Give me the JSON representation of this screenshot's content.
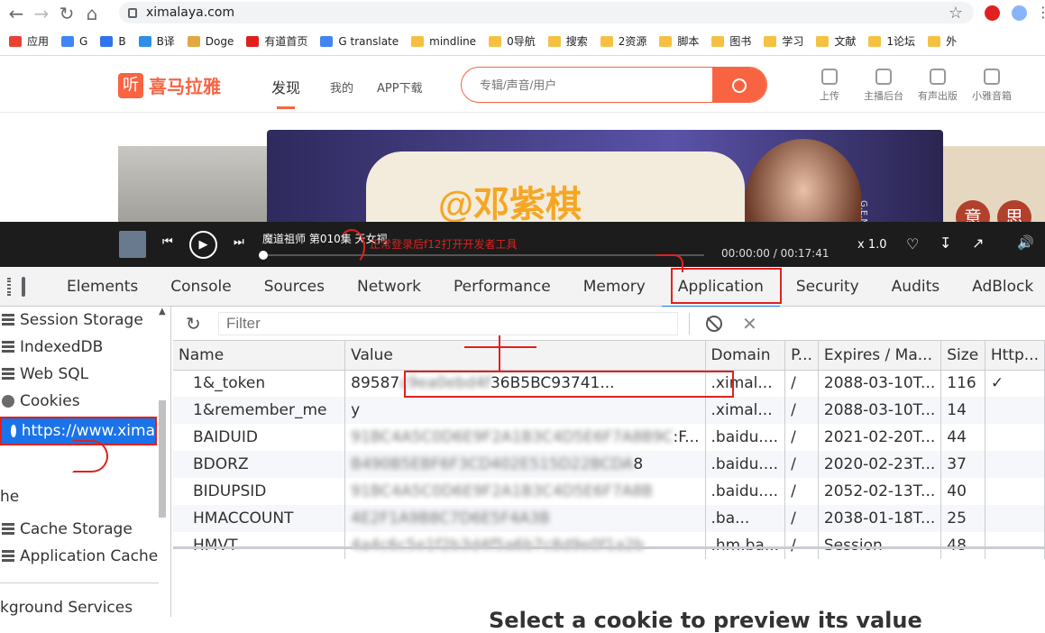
{
  "browser": {
    "url": "ximalaya.com",
    "bookmarks": [
      {
        "label": "应用",
        "color": "#e94235"
      },
      {
        "label": "G",
        "color": "#4285f4"
      },
      {
        "label": "B",
        "color": "#2f73ee"
      },
      {
        "label": "B译",
        "color": "#2e8fe8"
      },
      {
        "label": "Doge",
        "color": "#e3a742"
      },
      {
        "label": "有道首页",
        "color": "#e02020"
      },
      {
        "label": "G translate",
        "color": "#4285f4"
      },
      {
        "label": "mindline",
        "color": "#f6c142"
      },
      {
        "label": "0导航",
        "color": "#f6c142"
      },
      {
        "label": "搜索",
        "color": "#f6c142"
      },
      {
        "label": "2资源",
        "color": "#f6c142"
      },
      {
        "label": "脚本",
        "color": "#f6c142"
      },
      {
        "label": "图书",
        "color": "#f6c142"
      },
      {
        "label": "学习",
        "color": "#f6c142"
      },
      {
        "label": "文献",
        "color": "#f6c142"
      },
      {
        "label": "1论坛",
        "color": "#f6c142"
      },
      {
        "label": "外",
        "color": "#f6c142"
      }
    ]
  },
  "site": {
    "logo": "喜马拉雅",
    "nav": [
      "发现",
      "我的",
      "APP下载"
    ],
    "search_placeholder": "专辑/声音/用户",
    "right_icons": [
      "上传",
      "主播后台",
      "有声出版",
      "小雅音箱"
    ],
    "banner_text": "@邓紫棋",
    "banner_tag": "G.E.M.",
    "banner_right_chars": [
      "意",
      "思"
    ]
  },
  "player": {
    "track": "魔道祖师 第010集 天女祠",
    "time": "00:00:00 / 00:17:41",
    "speed": "x 1.0"
  },
  "annotations": {
    "step1": "正常登录后f12打开开发者工具"
  },
  "devtools": {
    "tabs": [
      "Elements",
      "Console",
      "Sources",
      "Network",
      "Performance",
      "Memory",
      "Application",
      "Security",
      "Audits",
      "AdBlock"
    ],
    "active_tab": "Application",
    "sidebar": {
      "items": [
        {
          "label": "Session Storage",
          "indent": 0
        },
        {
          "label": "IndexedDB",
          "indent": 0
        },
        {
          "label": "Web SQL",
          "indent": 0
        },
        {
          "label": "Cookies",
          "indent": 0
        },
        {
          "label": "https://www.xima",
          "indent": 0,
          "selected": true
        },
        {
          "label": "",
          "indent": 0
        },
        {
          "label": "he",
          "indent": 0
        },
        {
          "label": "Cache Storage",
          "indent": 0
        },
        {
          "label": "Application Cache",
          "indent": 0
        },
        {
          "label": "",
          "indent": 0
        },
        {
          "label": "kground Services",
          "indent": 0
        }
      ]
    },
    "filter_placeholder": "Filter",
    "columns": [
      "Name",
      "Value",
      "Domain",
      "P...",
      "Expires / Ma...",
      "Size",
      "Http..."
    ],
    "rows": [
      {
        "name": "1&_token",
        "value": "89587",
        "value_blur": "c9ea0ebd4f",
        "value_tail": "36B5BC93741...",
        "domain": ".ximal...",
        "path": "/",
        "expires": "2088-03-10T...",
        "size": "116",
        "http": "✓"
      },
      {
        "name": "1&remember_me",
        "value": "y",
        "value_blur": "",
        "value_tail": "",
        "domain": ".ximal...",
        "path": "/",
        "expires": "2088-03-10T...",
        "size": "14",
        "http": ""
      },
      {
        "name": "BAIDUID",
        "value": "",
        "value_blur": "91BC4A5C0D6E9F2A1B3C4D5E6F7A8B9C",
        "value_tail": ":F...",
        "domain": ".baidu....",
        "path": "/",
        "expires": "2021-02-20T...",
        "size": "44",
        "http": ""
      },
      {
        "name": "BDORZ",
        "value": "",
        "value_blur": "B490B5EBF6F3CD402E515D22BCDA",
        "value_tail": "8",
        "domain": ".baidu....",
        "path": "/",
        "expires": "2020-02-23T...",
        "size": "37",
        "http": ""
      },
      {
        "name": "BIDUPSID",
        "value": "",
        "value_blur": "91BC4A5C0D6E9F2A1B3C4D5E6F7A8B",
        "value_tail": "",
        "domain": ".baidu....",
        "path": "/",
        "expires": "2052-02-13T...",
        "size": "40",
        "http": ""
      },
      {
        "name": "HMACCOUNT",
        "value": "",
        "value_blur": "4E2F1A9B8C7D6E5F4A3B",
        "value_tail": "",
        "domain": ".ba...",
        "path": "/",
        "expires": "2038-01-18T...",
        "size": "25",
        "http": ""
      },
      {
        "name": "HMVT",
        "value": "",
        "value_blur": "4a4c6c5e1f2b3d4f5a6b7c8d9e0f1a2b",
        "value_tail": "",
        "domain": ".hm.ba...",
        "path": "/",
        "expires": "Session",
        "size": "48",
        "http": ""
      }
    ]
  },
  "bottom_partial": "Select a cookie to preview its value"
}
